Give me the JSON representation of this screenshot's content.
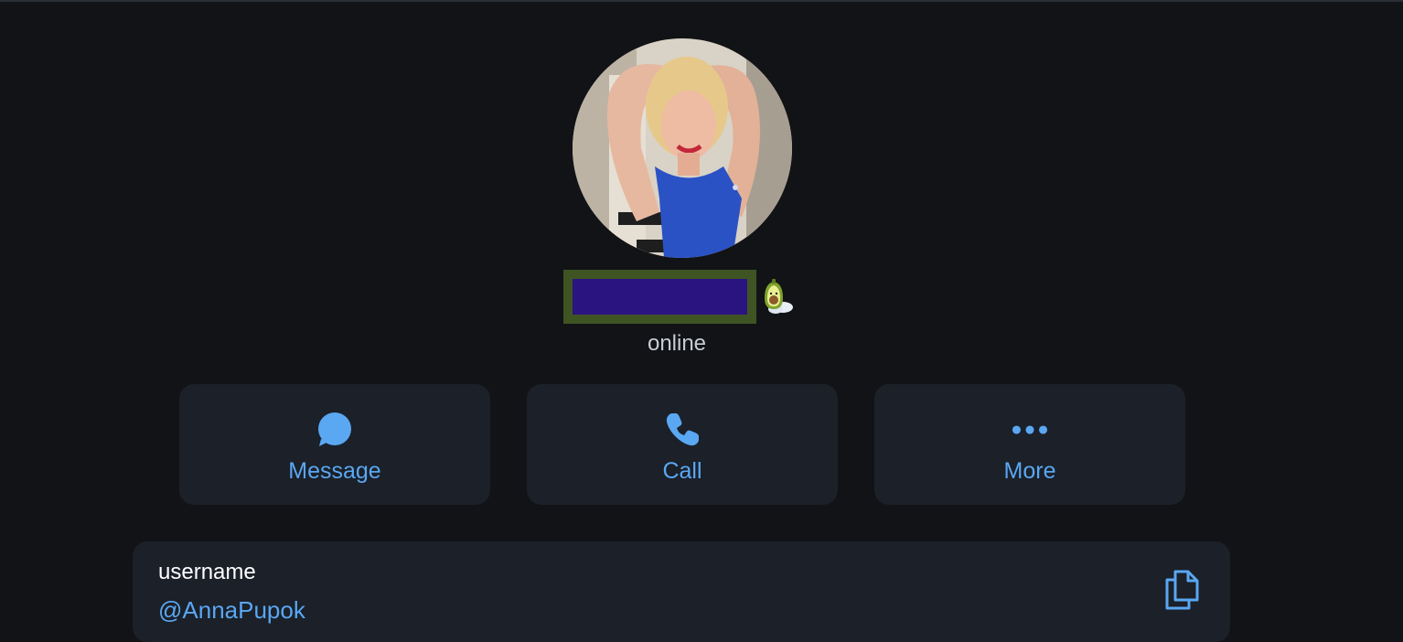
{
  "profile": {
    "status": "online",
    "avatar_icon": "profile-photo",
    "emoji_status_icon": "avocado-emoji-icon"
  },
  "actions": [
    {
      "label": "Message",
      "icon": "message-bubble-icon"
    },
    {
      "label": "Call",
      "icon": "phone-icon"
    },
    {
      "label": "More",
      "icon": "more-dots-icon"
    }
  ],
  "info": {
    "label": "username",
    "value": "@AnnaPupok",
    "copy_icon": "copy-icon"
  },
  "colors": {
    "background": "#121316",
    "card": "#1b2029",
    "accent": "#5aa7f2",
    "name_redaction_fill": "#2a1480",
    "name_redaction_border": "#3f5423"
  }
}
